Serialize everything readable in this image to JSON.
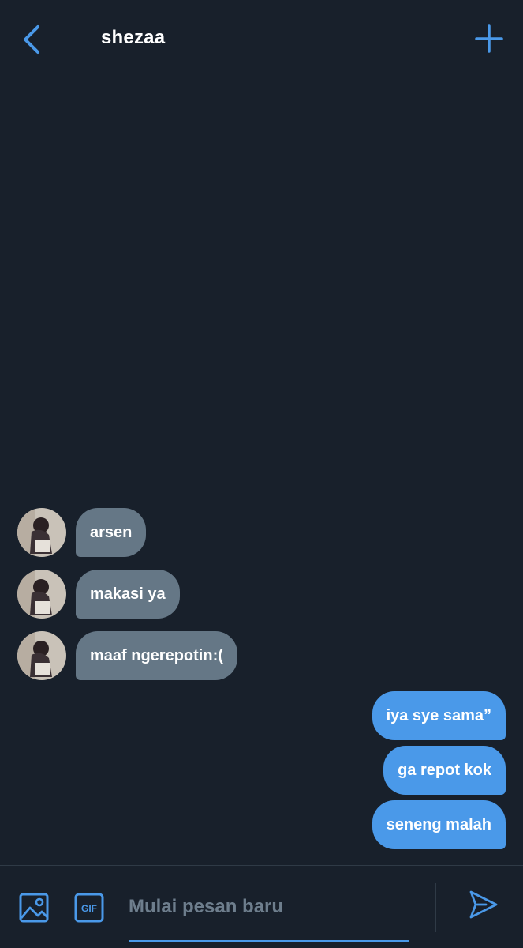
{
  "header": {
    "title": "shezaa",
    "back_icon": "chevron-left-icon",
    "action_icon": "plus-icon",
    "accent_color": "#4a99e9"
  },
  "messages": {
    "incoming": [
      {
        "text": "arsen"
      },
      {
        "text": "makasi ya"
      },
      {
        "text": "maaf ngerepotin:("
      }
    ],
    "outgoing": [
      {
        "text": "iya sye sama”"
      },
      {
        "text": "ga repot kok"
      },
      {
        "text": "seneng malah"
      }
    ],
    "incoming_bubble_color": "#657786",
    "outgoing_bubble_color": "#4a99e9"
  },
  "composer": {
    "image_icon": "image-icon",
    "gif_label": "GIF",
    "placeholder": "Mulai pesan baru",
    "value": "",
    "send_icon": "send-icon"
  },
  "theme": {
    "background": "#18202b",
    "divider": "#2f3a46"
  }
}
